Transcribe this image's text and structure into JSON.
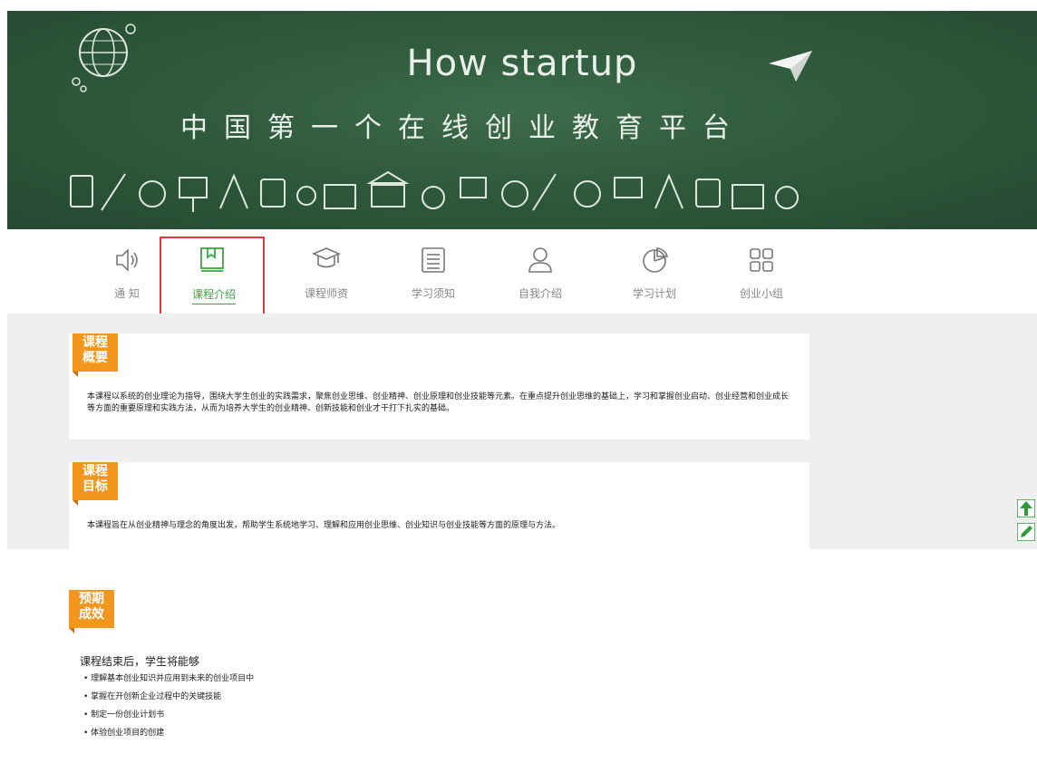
{
  "banner": {
    "title_en": "How startup",
    "title_cn": "中国第一个在线创业教育平台"
  },
  "nav": {
    "items": [
      {
        "label": "通 知",
        "icon": "speaker-icon"
      },
      {
        "label": "课程介绍",
        "icon": "book-icon",
        "active": true
      },
      {
        "label": "课程师资",
        "icon": "graduation-cap-icon"
      },
      {
        "label": "学习须知",
        "icon": "list-icon"
      },
      {
        "label": "自我介绍",
        "icon": "user-icon"
      },
      {
        "label": "学习计划",
        "icon": "pie-chart-icon"
      },
      {
        "label": "创业小组",
        "icon": "grid-icon"
      }
    ]
  },
  "sections": {
    "overview": {
      "tag_line1": "课程",
      "tag_line2": "概要",
      "text": "本课程以系统的创业理论为指导，围绕大学生创业的实践需求，聚焦创业思维、创业精神、创业原理和创业技能等元素。在重点提升创业思维的基础上，学习和掌握创业启动、创业经营和创业成长等方面的重要原理和实践方法，从而为培养大学生的创业精神、创新技能和创业才干打下扎实的基础。"
    },
    "goal": {
      "tag_line1": "课程",
      "tag_line2": "目标",
      "text": "本课程旨在从创业精神与理念的角度出发，帮助学生系统地学习、理解和应用创业思维、创业知识与创业技能等方面的原理与方法。"
    },
    "outcome": {
      "tag_line1": "预期",
      "tag_line2": "成效",
      "intro": "课程结束后，学生将能够",
      "items": [
        "理解基本创业知识并应用到未来的创业项目中",
        "掌握在开创新企业过程中的关键技能",
        "制定一份创业计划书",
        "体验创业项目的创建"
      ]
    }
  },
  "side_tools": {
    "top_icon": "arrow-up-icon",
    "edit_icon": "pencil-icon"
  },
  "colors": {
    "accent_green": "#3aa545",
    "tag_orange": "#f2961e",
    "highlight_red": "#e03a3a",
    "chalkboard": "#2f5a3d"
  }
}
